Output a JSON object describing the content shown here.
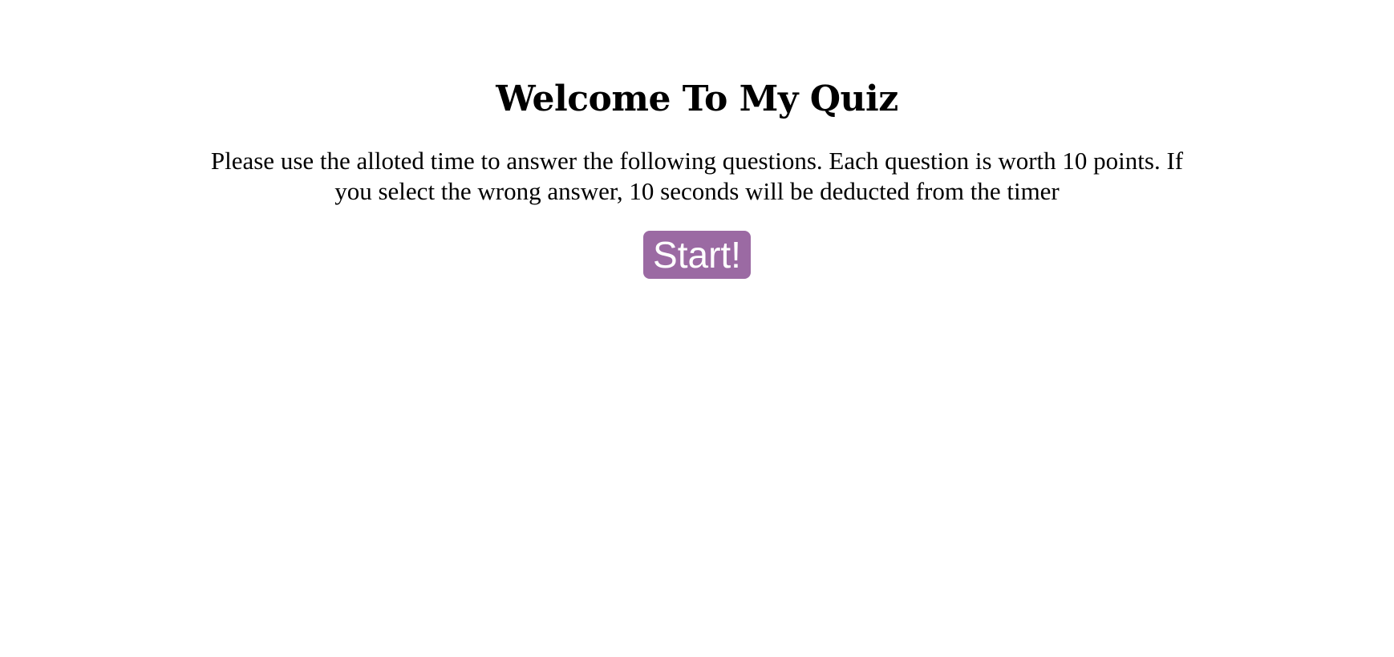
{
  "quiz": {
    "title": "Welcome To My Quiz",
    "instructions": "Please use the alloted time to answer the following questions. Each question is worth 10 points. If you select the wrong answer, 10 seconds will be deducted from the timer",
    "start_label": "Start!"
  },
  "colors": {
    "button_background": "#9b6aa3",
    "button_text": "#ffffff"
  }
}
